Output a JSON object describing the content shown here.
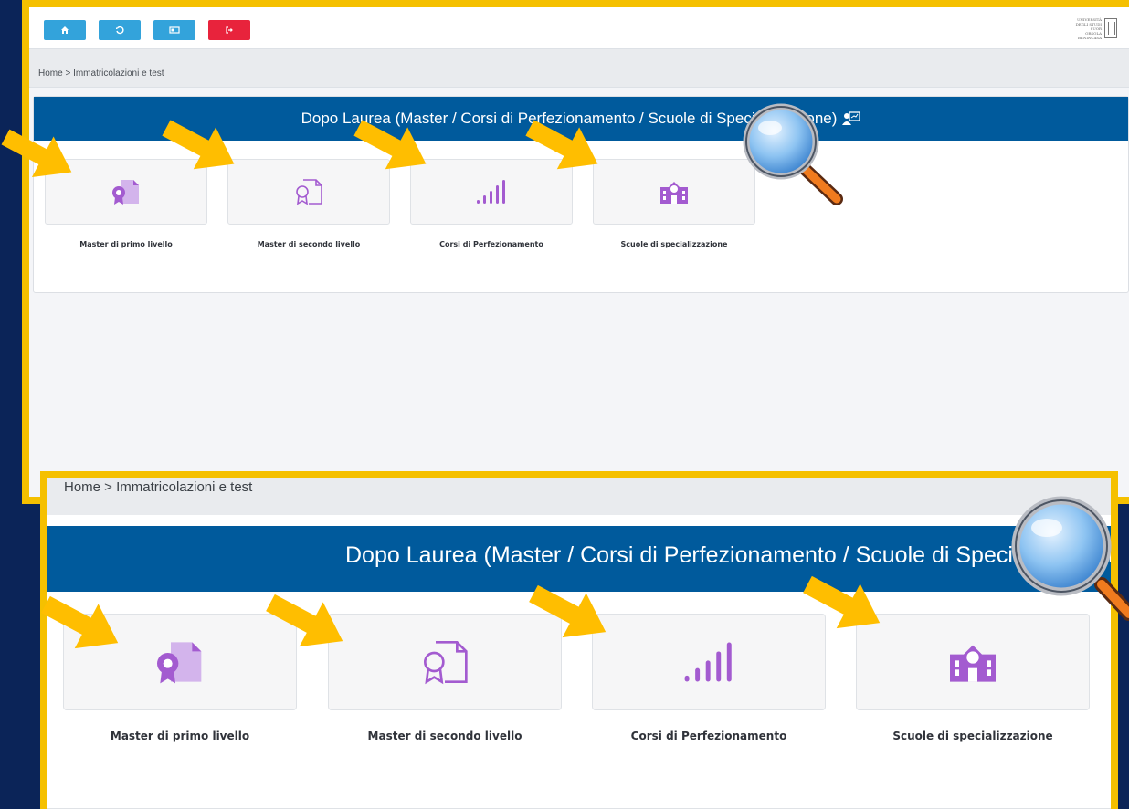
{
  "toolbar": {
    "home_icon": "home-icon",
    "history_icon": "history-icon",
    "card_icon": "id-card-icon",
    "logout_icon": "logout-icon",
    "logo_text": "UNIVERSITÀ DEGLI STUDI SUOR ORSOLA BENINCASA"
  },
  "breadcrumb": {
    "text": "Home > Immatricolazioni e test"
  },
  "section": {
    "title": "Dopo Laurea (Master / Corsi di Perfezionamento / Scuole di Specializzazione)",
    "title_visible_top": "Dopo Laurea (Master / Corsi di Perfezionamento / Scuole di Specializzazione)",
    "title_zoom": "Dopo Laurea (Master / Corsi di Perfezionamento / Scuole di Specializzazione)"
  },
  "tiles": [
    {
      "label": "Master di primo livello",
      "icon": "certificate-filled-icon"
    },
    {
      "label": "Master di secondo livello",
      "icon": "certificate-outline-icon"
    },
    {
      "label": "Corsi di Perfezionamento",
      "icon": "signal-bars-icon"
    },
    {
      "label": "Scuole di specializzazione",
      "icon": "school-icon"
    }
  ],
  "colors": {
    "background": "#0b2458",
    "frame": "#f5c000",
    "header": "#005a9c",
    "icon_purple": "#a35bd0",
    "button_blue": "#33a3db",
    "button_red": "#e8233c",
    "arrow": "#ffbe00"
  }
}
